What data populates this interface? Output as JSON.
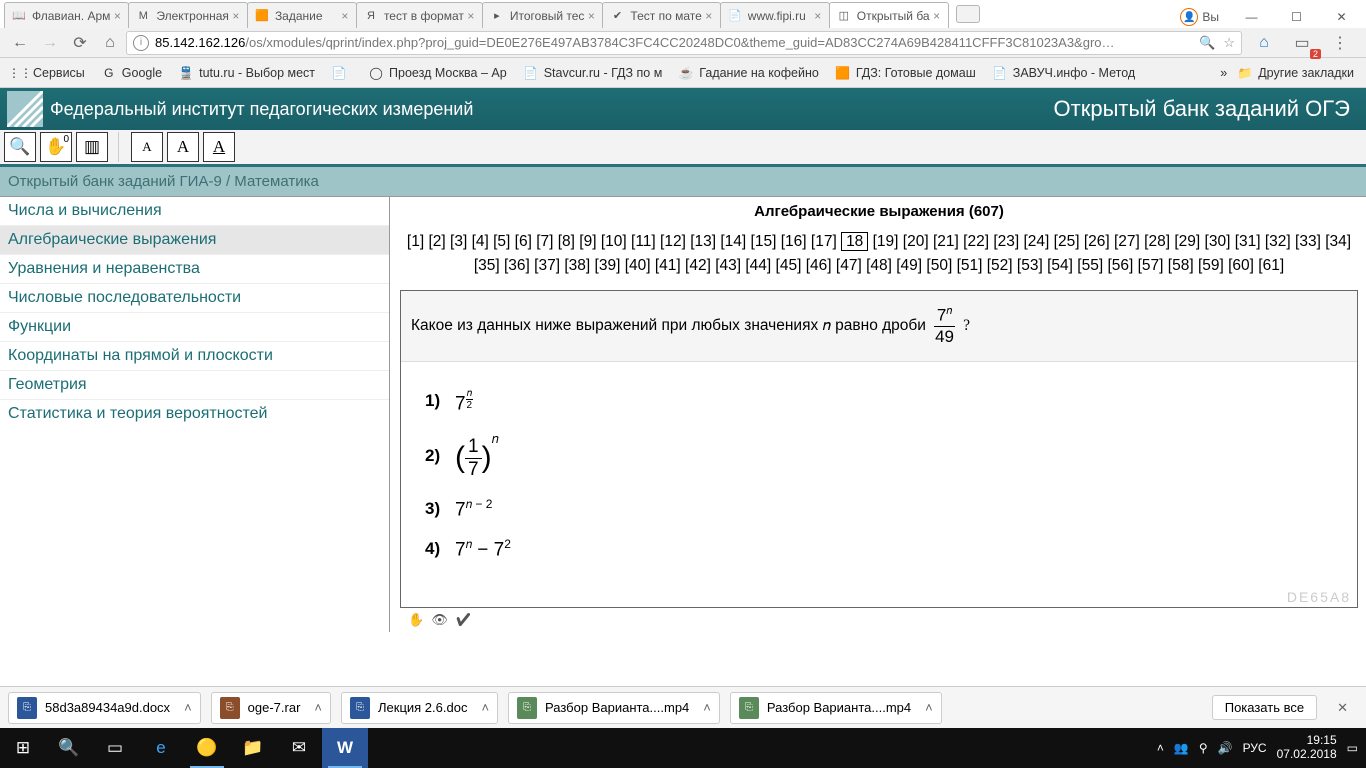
{
  "browser": {
    "tabs": [
      {
        "title": "Флавиан. Арм",
        "fav": "📖"
      },
      {
        "title": "Электронная",
        "fav": "M"
      },
      {
        "title": "Задание",
        "fav": "🟧"
      },
      {
        "title": "тест в формат",
        "fav": "Я"
      },
      {
        "title": "Итоговый тес",
        "fav": "▸"
      },
      {
        "title": "Тест по мате",
        "fav": "✔"
      },
      {
        "title": "www.fipi.ru",
        "fav": "📄"
      },
      {
        "title": "Открытый ба",
        "fav": "◫"
      }
    ],
    "user": "Вы",
    "url_host": "85.142.162.126",
    "url_path": "/os/xmodules/qprint/index.php?proj_guid=DE0E276E497AB3784C3FC4CC20248DC0&theme_guid=AD83CC274A69B428411CFFF3C81023A3&gro…",
    "bookmarks": [
      {
        "ico": "⋮⋮",
        "label": "Сервисы"
      },
      {
        "ico": "G",
        "label": "Google"
      },
      {
        "ico": "🚆",
        "label": "tutu.ru - Выбор мест"
      },
      {
        "ico": "📄",
        "label": ""
      },
      {
        "ico": "◯",
        "label": "Проезд Москва – Ар"
      },
      {
        "ico": "📄",
        "label": "Stavcur.ru - ГДЗ по м"
      },
      {
        "ico": "☕",
        "label": "Гадание на кофейно"
      },
      {
        "ico": "🟧",
        "label": "ГДЗ: Готовые домаш"
      },
      {
        "ico": "📄",
        "label": "ЗАВУЧ.инфо - Метод"
      }
    ],
    "other_bookmarks": "Другие закладки"
  },
  "page": {
    "org": "Федеральный институт педагогических измерений",
    "bank": "Открытый банк заданий ОГЭ",
    "breadcrumb": "Открытый банк заданий ГИА-9 / Математика",
    "sidebar": [
      "Числа и вычисления",
      "Алгебраические выражения",
      "Уравнения и неравенства",
      "Числовые последовательности",
      "Функции",
      "Координаты на прямой и плоскости",
      "Геометрия",
      "Статистика и теория вероятностей"
    ],
    "section": "Алгебраические выражения (607)",
    "current_page": 18,
    "total_pages": 61,
    "question": "Какое из данных ниже выражений при любых значениях 𝑛 равно дроби",
    "q_id": "DE65A8",
    "hand_badge": "0"
  },
  "downloads": {
    "items": [
      {
        "name": "58d3a89434a9d.docx",
        "cls": "doc"
      },
      {
        "name": "oge-7.rar",
        "cls": "rar"
      },
      {
        "name": "Лекция 2.6.doc",
        "cls": "doc"
      },
      {
        "name": "Разбор Варианта....mp4",
        "cls": "mp4"
      },
      {
        "name": "Разбор Варианта....mp4",
        "cls": "mp4"
      }
    ],
    "show_all": "Показать все"
  },
  "taskbar": {
    "lang": "РУС",
    "time": "19:15",
    "date": "07.02.2018"
  }
}
